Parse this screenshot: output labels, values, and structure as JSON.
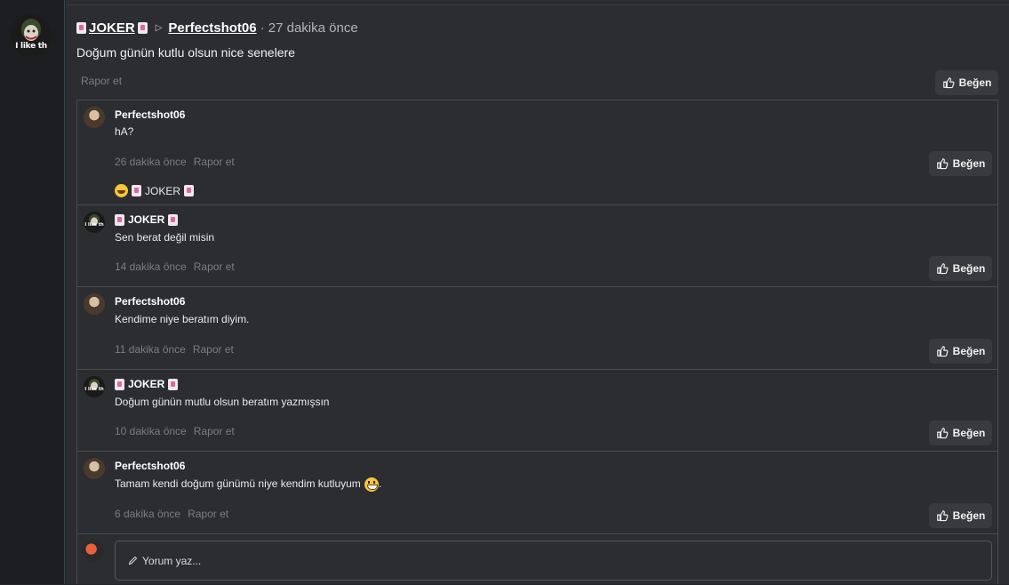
{
  "main_post": {
    "author": "JOKER",
    "reply_to": "Perfectshot06",
    "time": "· 27 dakika önce",
    "text": "Doğum günün kutlu olsun nice senelere",
    "report_label": "Rapor et",
    "like_label": "Beğen",
    "avatar_caption": "I like th"
  },
  "replies": [
    {
      "author": "Perfectshot06",
      "text": "hA?",
      "time": "26 dakika önce",
      "report_label": "Rapor et",
      "like_label": "Beğen",
      "reaction_user": "JOKER",
      "avatar": "perfectshot"
    },
    {
      "author": "JOKER",
      "text": "Sen berat değil misin",
      "time": "14 dakika önce",
      "report_label": "Rapor et",
      "like_label": "Beğen",
      "avatar": "joker",
      "avatar_caption": "I like th"
    },
    {
      "author": "Perfectshot06",
      "text": "Kendime niye beratım diyim.",
      "time": "11 dakika önce",
      "report_label": "Rapor et",
      "like_label": "Beğen",
      "avatar": "perfectshot"
    },
    {
      "author": "JOKER",
      "text": "Doğum günün mutlu olsun beratım yazmışsın",
      "time": "10 dakika önce",
      "report_label": "Rapor et",
      "like_label": "Beğen",
      "avatar": "joker",
      "avatar_caption": "I like th"
    },
    {
      "author": "Perfectshot06",
      "text": "Tamam kendi doğum günümü niye kendim kutluyum",
      "text_suffix": ".",
      "time": "6 dakika önce",
      "report_label": "Rapor et",
      "like_label": "Beğen",
      "avatar": "perfectshot"
    }
  ],
  "composer": {
    "placeholder": "Yorum yaz..."
  },
  "icons": {
    "like": "thumbs-up-icon",
    "reply_arrow": "caret-right-icon",
    "composer": "pencil-icon",
    "name_badge": "card-emoji-icon",
    "reaction_laugh": "rofl-emoji-icon",
    "grin": "grinning-emoji-icon"
  },
  "colors": {
    "background": "#2b2d31",
    "rail": "#1c1e21",
    "button": "#383a3f",
    "muted": "#7b7d82"
  }
}
